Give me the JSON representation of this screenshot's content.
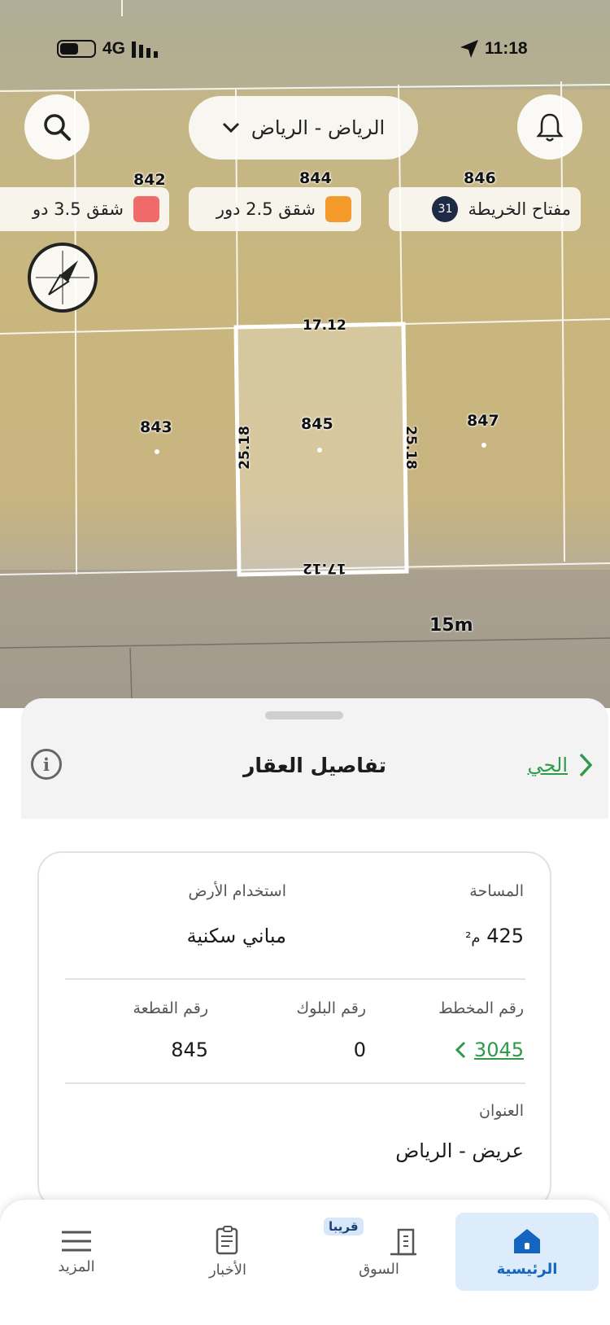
{
  "status_bar": {
    "time": "11:18",
    "network": "4G"
  },
  "map": {
    "city_select": "الرياض - الرياض",
    "legend": [
      {
        "label": "مفتاح الخريطة",
        "badge": "31"
      },
      {
        "label": "شقق 2.5 دور",
        "color": "#f39a2a"
      },
      {
        "label": "شقق 3.5 دو",
        "color": "#f06a6a"
      }
    ],
    "plots": [
      "842",
      "844",
      "846",
      "843",
      "845",
      "847"
    ],
    "dimensions": {
      "top": "17.12",
      "left": "25.18",
      "right": "25.18",
      "bottom": "17.12"
    },
    "street_width": "15m",
    "icons": {
      "search": "search-icon",
      "bell": "bell-icon",
      "compass": "compass-icon"
    }
  },
  "sheet": {
    "title": "تفاصيل العقار",
    "district_link": "الحي",
    "area_label": "المساحة",
    "area_value": "425",
    "area_unit": "م²",
    "land_use_label": "استخدام الأرض",
    "land_use_value": "مباني سكنية",
    "plan_label": "رقم المخطط",
    "plan_value": "3045",
    "block_label": "رقم البلوك",
    "block_value": "0",
    "parcel_label": "رقم القطعة",
    "parcel_value": "845",
    "address_label": "العنوان",
    "address_value": "عريض - الرياض"
  },
  "nav": {
    "home": "الرئيسية",
    "market": "السوق",
    "market_badge": "قريبا",
    "news": "الأخبار",
    "more": "المزيد"
  }
}
